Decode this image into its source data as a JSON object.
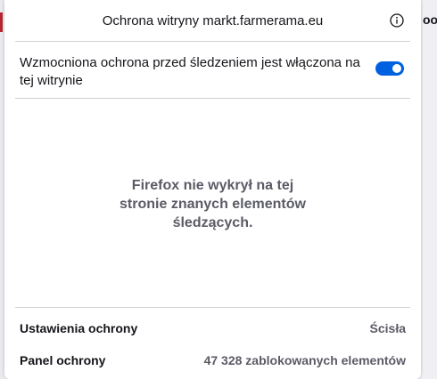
{
  "background": {
    "right_text": "oog"
  },
  "panel": {
    "title": "Ochrona witryny markt.farmerama.eu",
    "info_icon": "info-icon",
    "tracking_protection": {
      "text": "Wzmocniona ochrona przed śledzeniem jest włączona na tej witrynie",
      "enabled": true
    },
    "empty_message": {
      "lines": [
        "Firefox nie wykrył na tej",
        "stronie znanych elementów",
        "śledzących."
      ]
    },
    "settings_row": {
      "label": "Ustawienia ochrony",
      "value": "Ścisła"
    },
    "dashboard_row": {
      "label": "Panel ochrony",
      "value": "47 328 zablokowanych elementów"
    }
  },
  "colors": {
    "accent": "#0061e0",
    "text_primary": "#15141a",
    "text_secondary": "#5b5b66",
    "separator": "#d0d0d7"
  }
}
